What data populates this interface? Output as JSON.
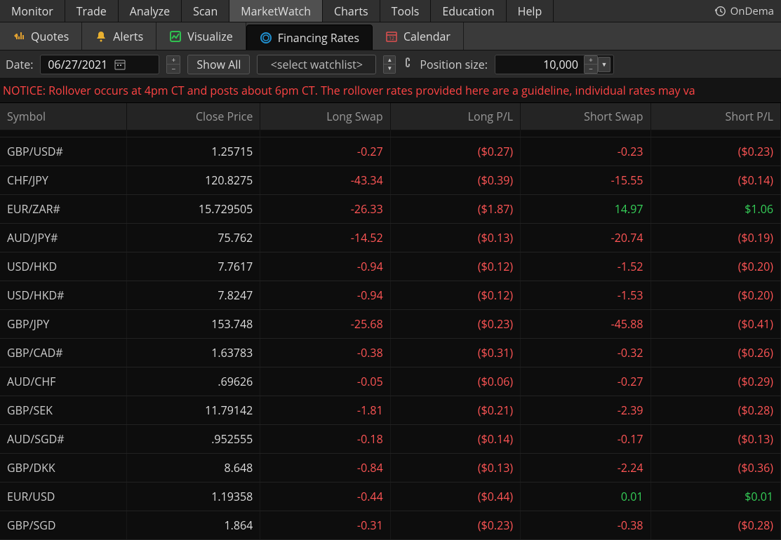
{
  "main_menu": {
    "items": [
      "Monitor",
      "Trade",
      "Analyze",
      "Scan",
      "MarketWatch",
      "Charts",
      "Tools",
      "Education",
      "Help"
    ],
    "active_index": 4,
    "ondemand_label": "OnDema"
  },
  "sub_tabs": {
    "items": [
      {
        "label": "Quotes",
        "icon": "quotes"
      },
      {
        "label": "Alerts",
        "icon": "alerts"
      },
      {
        "label": "Visualize",
        "icon": "visualize"
      },
      {
        "label": "Financing Rates",
        "icon": "financing"
      },
      {
        "label": "Calendar",
        "icon": "calendar"
      }
    ],
    "active_index": 3
  },
  "toolbar": {
    "date_label": "Date:",
    "date_value": "06/27/2021",
    "show_all_label": "Show All",
    "watchlist_placeholder": "<select watchlist>",
    "position_size_label": "Position size:",
    "position_size_value": "10,000"
  },
  "notice": "NOTICE: Rollover occurs at 4pm CT and posts about 6pm CT. The rollover rates provided here are a guideline, individual rates may va",
  "columns": [
    "Symbol",
    "Close Price",
    "Long Swap",
    "Long P/L",
    "Short Swap",
    "Short P/L"
  ],
  "rows": [
    {
      "symbol": "GBP/USD#",
      "close": "1.25715",
      "long_swap": "-0.27",
      "long_pl": "($0.27)",
      "short_swap": "-0.23",
      "short_pl": "($0.23)",
      "ss_pos": false,
      "sp_pos": false
    },
    {
      "symbol": "CHF/JPY",
      "close": "120.8275",
      "long_swap": "-43.34",
      "long_pl": "($0.39)",
      "short_swap": "-15.55",
      "short_pl": "($0.14)",
      "ss_pos": false,
      "sp_pos": false
    },
    {
      "symbol": "EUR/ZAR#",
      "close": "15.729505",
      "long_swap": "-26.33",
      "long_pl": "($1.87)",
      "short_swap": "14.97",
      "short_pl": "$1.06",
      "ss_pos": true,
      "sp_pos": true
    },
    {
      "symbol": "AUD/JPY#",
      "close": "75.762",
      "long_swap": "-14.52",
      "long_pl": "($0.13)",
      "short_swap": "-20.74",
      "short_pl": "($0.19)",
      "ss_pos": false,
      "sp_pos": false
    },
    {
      "symbol": "USD/HKD",
      "close": "7.7617",
      "long_swap": "-0.94",
      "long_pl": "($0.12)",
      "short_swap": "-1.52",
      "short_pl": "($0.20)",
      "ss_pos": false,
      "sp_pos": false
    },
    {
      "symbol": "USD/HKD#",
      "close": "7.8247",
      "long_swap": "-0.94",
      "long_pl": "($0.12)",
      "short_swap": "-1.53",
      "short_pl": "($0.20)",
      "ss_pos": false,
      "sp_pos": false
    },
    {
      "symbol": "GBP/JPY",
      "close": "153.748",
      "long_swap": "-25.68",
      "long_pl": "($0.23)",
      "short_swap": "-45.88",
      "short_pl": "($0.41)",
      "ss_pos": false,
      "sp_pos": false
    },
    {
      "symbol": "GBP/CAD#",
      "close": "1.63783",
      "long_swap": "-0.38",
      "long_pl": "($0.31)",
      "short_swap": "-0.32",
      "short_pl": "($0.26)",
      "ss_pos": false,
      "sp_pos": false
    },
    {
      "symbol": "AUD/CHF",
      "close": ".69626",
      "long_swap": "-0.05",
      "long_pl": "($0.06)",
      "short_swap": "-0.27",
      "short_pl": "($0.29)",
      "ss_pos": false,
      "sp_pos": false
    },
    {
      "symbol": "GBP/SEK",
      "close": "11.79142",
      "long_swap": "-1.81",
      "long_pl": "($0.21)",
      "short_swap": "-2.39",
      "short_pl": "($0.28)",
      "ss_pos": false,
      "sp_pos": false
    },
    {
      "symbol": "AUD/SGD#",
      "close": ".952555",
      "long_swap": "-0.18",
      "long_pl": "($0.14)",
      "short_swap": "-0.17",
      "short_pl": "($0.13)",
      "ss_pos": false,
      "sp_pos": false
    },
    {
      "symbol": "GBP/DKK",
      "close": "8.648",
      "long_swap": "-0.84",
      "long_pl": "($0.13)",
      "short_swap": "-2.24",
      "short_pl": "($0.36)",
      "ss_pos": false,
      "sp_pos": false
    },
    {
      "symbol": "EUR/USD",
      "close": "1.19358",
      "long_swap": "-0.44",
      "long_pl": "($0.44)",
      "short_swap": "0.01",
      "short_pl": "$0.01",
      "ss_pos": true,
      "sp_pos": true
    },
    {
      "symbol": "GBP/SGD",
      "close": "1.864",
      "long_swap": "-0.31",
      "long_pl": "($0.23)",
      "short_swap": "-0.38",
      "short_pl": "($0.28)",
      "ss_pos": false,
      "sp_pos": false
    }
  ]
}
